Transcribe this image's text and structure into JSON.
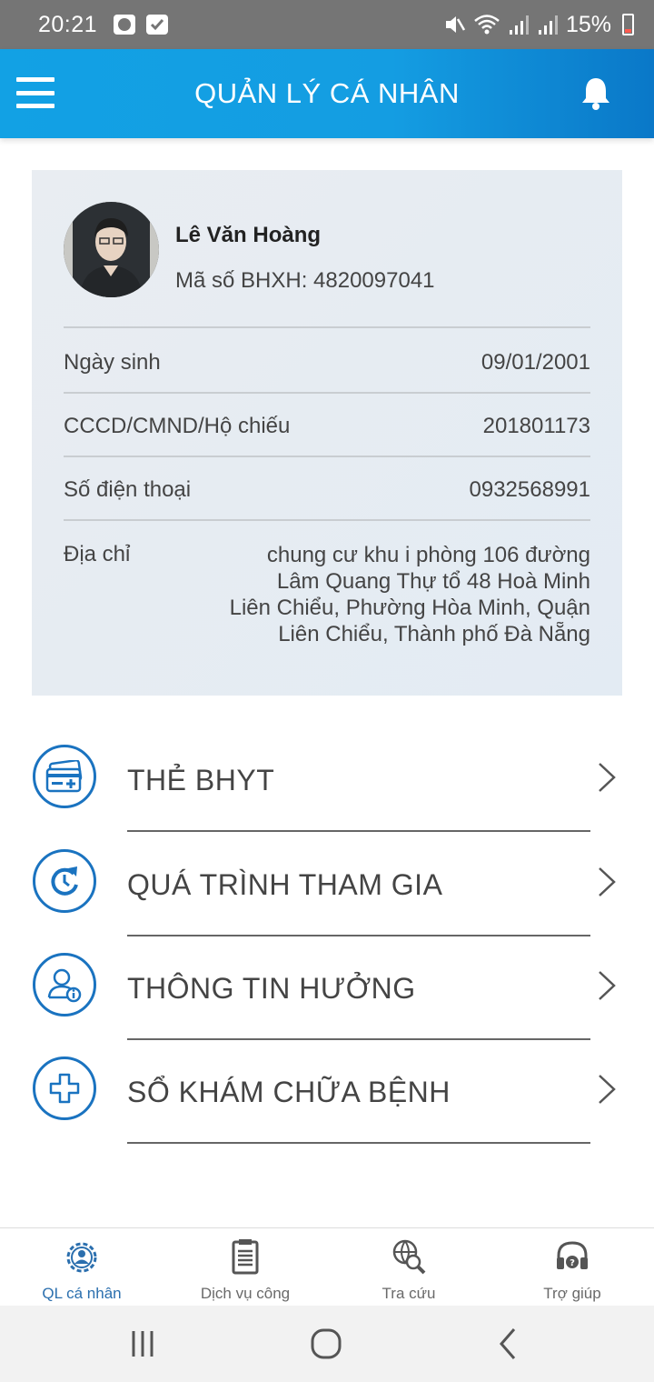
{
  "status_bar": {
    "time": "20:21",
    "battery": "15%"
  },
  "header": {
    "title": "QUẢN LÝ CÁ NHÂN"
  },
  "profile": {
    "name": "Lê Văn Hoàng",
    "bhxh": "Mã số BHXH: 4820097041",
    "rows": [
      {
        "label": "Ngày sinh",
        "value": "09/01/2001"
      },
      {
        "label": "CCCD/CMND/Hộ chiếu",
        "value": "201801173"
      },
      {
        "label": "Số điện thoại",
        "value": "0932568991"
      }
    ],
    "address": {
      "label": "Địa chỉ",
      "lines": [
        "chung cư khu i phòng 106 đường",
        "Lâm Quang Thự  tổ 48 Hoà Minh",
        "Liên Chiểu, Phường Hòa Minh, Quận",
        "Liên Chiểu, Thành phố Đà Nẵng"
      ]
    }
  },
  "menu": [
    {
      "label": "THẺ BHYT",
      "icon": "health-card-icon"
    },
    {
      "label": "QUÁ TRÌNH THAM GIA",
      "icon": "history-refresh-icon"
    },
    {
      "label": "THÔNG TIN HƯỞNG",
      "icon": "user-info-icon"
    },
    {
      "label": "SỔ KHÁM CHỮA BỆNH",
      "icon": "medical-cross-icon"
    }
  ],
  "bottom_nav": [
    {
      "label": "QL cá nhân",
      "icon": "personal-gear-icon",
      "active": true
    },
    {
      "label": "Dịch vụ công",
      "icon": "document-icon",
      "active": false
    },
    {
      "label": "Tra cứu",
      "icon": "globe-search-icon",
      "active": false
    },
    {
      "label": "Trợ giúp",
      "icon": "headset-help-icon",
      "active": false
    }
  ],
  "colors": {
    "header_blue": "#12a1e4",
    "icon_blue": "#1a73c0",
    "card_bg": "#e6ecf2"
  }
}
